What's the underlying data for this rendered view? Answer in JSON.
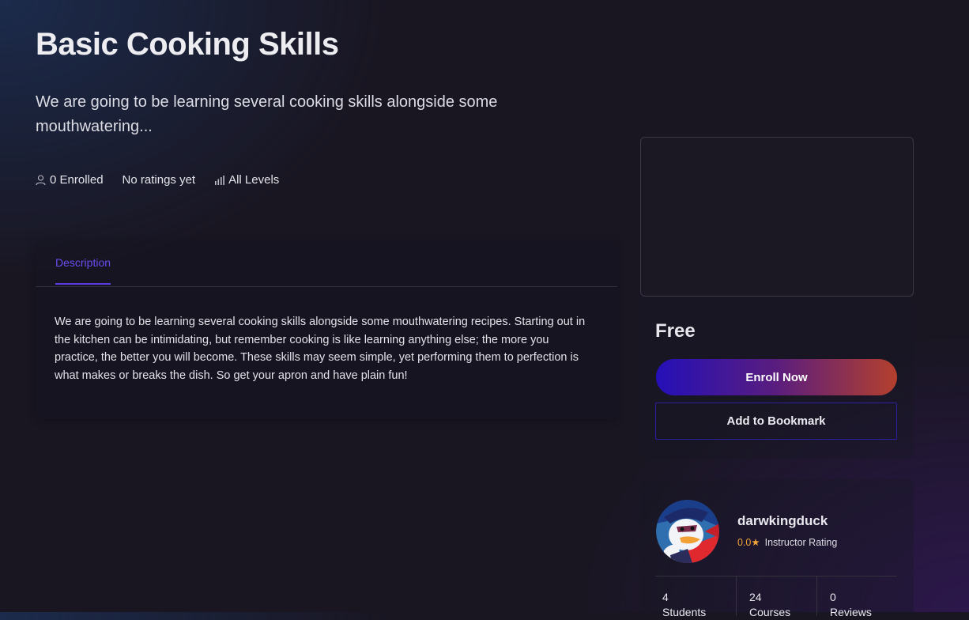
{
  "course": {
    "title": "Basic Cooking Skills",
    "subtitle": "We are going to be learning several cooking skills alongside some mouthwatering...",
    "meta": {
      "enrolled": "0 Enrolled",
      "ratings": "No ratings yet",
      "level": "All Levels"
    }
  },
  "tabs": [
    {
      "label": "Description",
      "active": true
    }
  ],
  "description": "We are going to be learning several cooking skills alongside some mouthwatering recipes. Starting out in the kitchen can be intimidating, but remember cooking is like learning anything else; the more you practice, the better you will become. These skills may seem simple, yet performing them to perfection is what makes or breaks the dish.  So get your apron and have plain fun!",
  "pricing": {
    "price": "Free",
    "enroll_label": "Enroll Now",
    "bookmark_label": "Add to Bookmark"
  },
  "instructor": {
    "name": "darwkingduck",
    "rating_value": "0.0",
    "rating_label": "Instructor Rating",
    "stats": [
      {
        "value": "4",
        "label": "Students"
      },
      {
        "value": "24",
        "label": "Courses"
      },
      {
        "value": "0",
        "label": "Reviews"
      }
    ]
  },
  "colors": {
    "accent": "#5a3ce0",
    "enroll_gradient_start": "#2410b8",
    "enroll_gradient_end": "#b4402d",
    "rating": "#f0a23a"
  },
  "icons": {
    "enrolled": "user-icon",
    "level": "bar-chart-icon",
    "rating": "star-icon"
  }
}
